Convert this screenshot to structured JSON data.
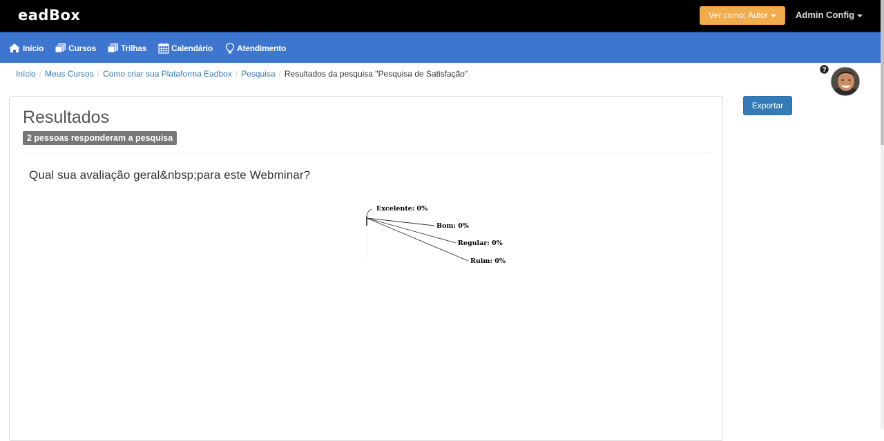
{
  "app": {
    "brand": "eadBox",
    "view_as_label": "Ver como: Autor",
    "admin_label": "Admin Config"
  },
  "nav": {
    "items": [
      {
        "label": "Início",
        "icon": "home-icon"
      },
      {
        "label": "Cursos",
        "icon": "courses-icon"
      },
      {
        "label": "Trilhas",
        "icon": "tracks-icon"
      },
      {
        "label": "Calendário",
        "icon": "calendar-icon"
      },
      {
        "label": "Atendimento",
        "icon": "lightbulb-icon"
      }
    ]
  },
  "breadcrumb": {
    "items": [
      "Início",
      "Meus Cursos",
      "Como criar sua Plataforma Eadbox",
      "Pesquisa"
    ],
    "current": "Resultados da pesquisa \"Pesquisa de Satisfação\""
  },
  "main": {
    "title": "Resultados",
    "count_badge": "2 pessoas responderam a pesquisa",
    "question": "Qual sua avaliação geral&nbsp;para este Webminar?",
    "export_label": "Exportar"
  },
  "colors": {
    "topbar": "#000000",
    "navbar": "#3d75cf",
    "view_as_button": "#f0ad4e",
    "export_button": "#337ab7",
    "badge": "#777777"
  },
  "chart_data": {
    "type": "pie",
    "categories": [
      "Excelente",
      "Bom",
      "Regular",
      "Ruim"
    ],
    "values": [
      0,
      0,
      0,
      0
    ],
    "data_labels": [
      "Excelente: 0%",
      "Bom: 0%",
      "Regular: 0%",
      "Ruim: 0%"
    ],
    "title": "",
    "legend": "none"
  }
}
